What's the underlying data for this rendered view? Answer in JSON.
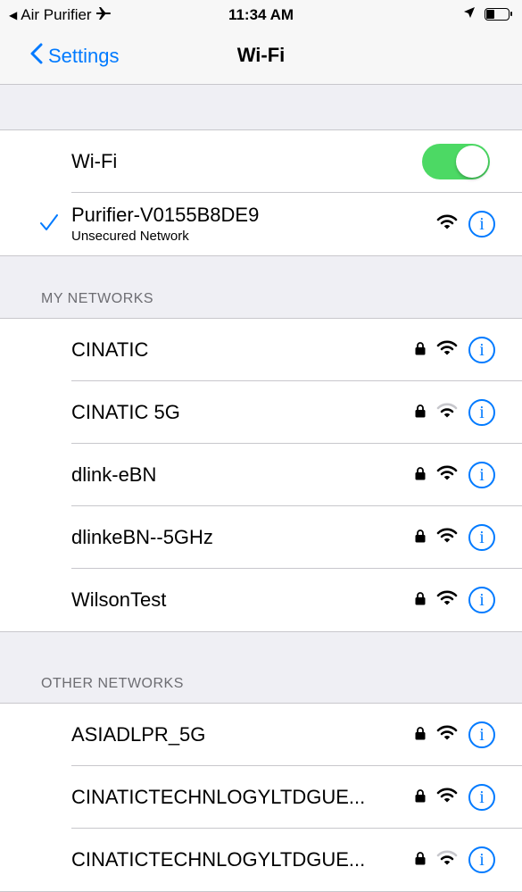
{
  "status_bar": {
    "back_app": "Air Purifier",
    "time": "11:34 AM",
    "icons": [
      "airplane-icon",
      "location-arrow-icon",
      "battery-icon"
    ]
  },
  "nav": {
    "back_label": "Settings",
    "title": "Wi-Fi"
  },
  "wifi": {
    "label": "Wi-Fi",
    "enabled": true,
    "toggle_color": "#4cd964"
  },
  "connected": {
    "name": "Purifier-V0155B8DE9",
    "subtitle": "Unsecured Network",
    "secured": false
  },
  "my_networks": {
    "header": "MY NETWORKS",
    "items": [
      {
        "name": "CINATIC",
        "secured": true,
        "signal": "full"
      },
      {
        "name": "CINATIC 5G",
        "secured": true,
        "signal": "partial"
      },
      {
        "name": "dlink-eBN",
        "secured": true,
        "signal": "full"
      },
      {
        "name": "dlinkeBN--5GHz",
        "secured": true,
        "signal": "full"
      },
      {
        "name": "WilsonTest",
        "secured": true,
        "signal": "full"
      }
    ]
  },
  "other_networks": {
    "header": "OTHER NETWORKS",
    "items": [
      {
        "name": "ASIADLPR_5G",
        "secured": true,
        "signal": "full"
      },
      {
        "name": "CINATICTECHNLOGYLTDGUE...",
        "secured": true,
        "signal": "full"
      },
      {
        "name": "CINATICTECHNLOGYLTDGUE...",
        "secured": true,
        "signal": "partial"
      }
    ]
  },
  "colors": {
    "accent": "#007aff",
    "background": "#efeff4",
    "separator": "#c8c7cc",
    "header_text": "#6d6d72"
  }
}
